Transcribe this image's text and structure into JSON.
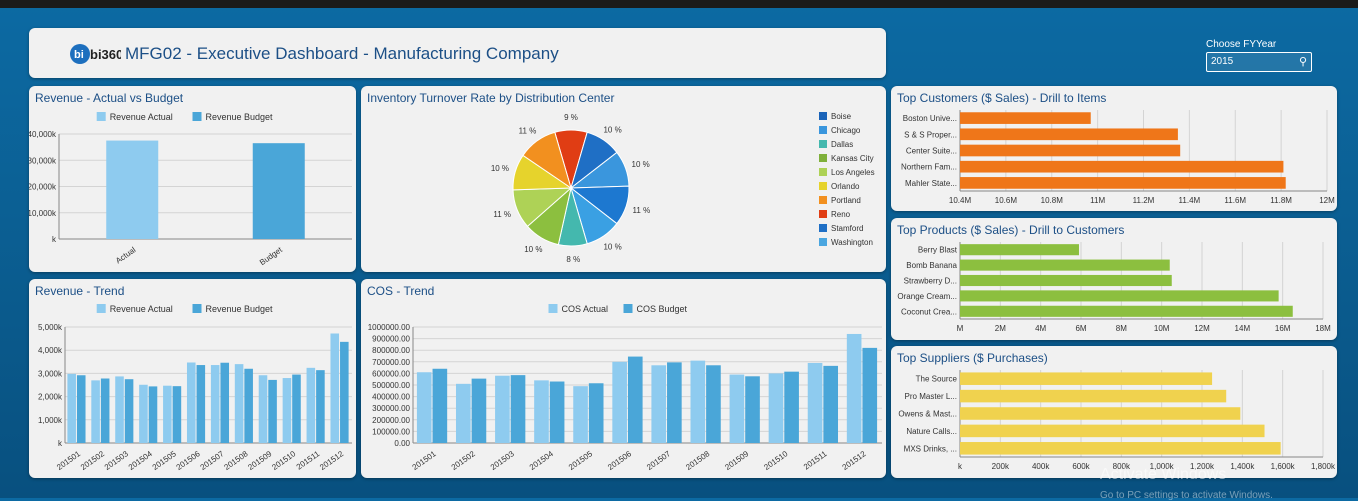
{
  "header": {
    "logo_text": "bi360",
    "title": "MFG02 - Executive Dashboard - Manufacturing Company"
  },
  "filter": {
    "label": "Choose FYYear",
    "value": "2015",
    "icon": "search-icon"
  },
  "watermark": {
    "line1": "Activate Windows",
    "line2": "Go to PC settings to activate Windows."
  },
  "colors": {
    "actual": "#8ecbef",
    "budget": "#4aa6d8",
    "customers": "#ef7619",
    "products": "#8cbf3f",
    "suppliers": "#f0d24e",
    "panel_title": "#1c4f86"
  },
  "panels": {
    "revenue_actual_budget": {
      "title": "Revenue - Actual vs Budget"
    },
    "inventory_turnover": {
      "title": "Inventory Turnover Rate by Distribution Center"
    },
    "revenue_trend": {
      "title": "Revenue - Trend"
    },
    "cos_trend": {
      "title": "COS - Trend"
    },
    "top_customers": {
      "title": "Top Customers ($ Sales) - Drill to Items"
    },
    "top_products": {
      "title": "Top Products ($ Sales) - Drill to Customers"
    },
    "top_suppliers": {
      "title": "Top Suppliers ($ Purchases)"
    }
  },
  "chart_data": [
    {
      "id": "rev_avb",
      "type": "bar",
      "title": "Revenue - Actual vs Budget",
      "categories": [
        "Actual",
        "Budget"
      ],
      "series": [
        {
          "name": "Revenue Actual",
          "values": [
            37500,
            0
          ]
        },
        {
          "name": "Revenue Budget",
          "values": [
            0,
            36500
          ]
        }
      ],
      "yticks": [
        "40,000k",
        "30,000k",
        "20,000k",
        "10,000k",
        "k"
      ],
      "ylim": [
        0,
        40000
      ],
      "legend": "top"
    },
    {
      "id": "inv_pie",
      "type": "pie",
      "title": "Inventory Turnover Rate by Distribution Center",
      "slices": [
        {
          "name": "Boise",
          "value": 10,
          "label": "10 %",
          "color": "#1f6fc5"
        },
        {
          "name": "Chicago",
          "value": 10,
          "label": "10 %",
          "color": "#3a96dd"
        },
        {
          "name": "Dallas",
          "value": 11,
          "label": "11 %",
          "color": "#1d78d0"
        },
        {
          "name": "Kansas City",
          "value": 10,
          "label": "10 %",
          "color": "#3aa0e3"
        },
        {
          "name": "Los Angeles",
          "value": 8,
          "label": "8 %",
          "color": "#44b8ae"
        },
        {
          "name": "Orlando",
          "value": 10,
          "label": "10 %",
          "color": "#8cbf3f"
        },
        {
          "name": "Portland",
          "value": 11,
          "label": "11 %",
          "color": "#aed256"
        },
        {
          "name": "Reno",
          "value": 10,
          "label": "10 %",
          "color": "#e6d32c"
        },
        {
          "name": "Stamford",
          "value": 11,
          "label": "11 %",
          "color": "#f2901f"
        },
        {
          "name": "Washington",
          "value": 9,
          "label": "9 %",
          "color": "#e03d14"
        }
      ],
      "legend": [
        {
          "name": "Boise",
          "color": "#1a63b8"
        },
        {
          "name": "Chicago",
          "color": "#3a96dd"
        },
        {
          "name": "Dallas",
          "color": "#44b8ae"
        },
        {
          "name": "Kansas City",
          "color": "#7fb03b"
        },
        {
          "name": "Los Angeles",
          "color": "#aed256"
        },
        {
          "name": "Orlando",
          "color": "#e6d32c"
        },
        {
          "name": "Portland",
          "color": "#f2901f"
        },
        {
          "name": "Reno",
          "color": "#e03d14"
        },
        {
          "name": "Stamford",
          "color": "#1f6fc5"
        },
        {
          "name": "Washington",
          "color": "#4aa6e0"
        }
      ]
    },
    {
      "id": "rev_trend",
      "type": "bar",
      "title": "Revenue - Trend",
      "categories": [
        "201501",
        "201502",
        "201503",
        "201504",
        "201505",
        "201506",
        "201507",
        "201508",
        "201509",
        "201510",
        "201511",
        "201512"
      ],
      "series": [
        {
          "name": "Revenue Actual",
          "values": [
            2980,
            2700,
            2870,
            2510,
            2470,
            3470,
            3360,
            3400,
            2920,
            2800,
            3240,
            4720
          ]
        },
        {
          "name": "Revenue Budget",
          "values": [
            2920,
            2780,
            2750,
            2440,
            2450,
            3360,
            3460,
            3200,
            2720,
            2950,
            3140,
            4360
          ]
        }
      ],
      "yticks": [
        "5,000k",
        "4,000k",
        "3,000k",
        "2,000k",
        "1,000k",
        "k"
      ],
      "ylim": [
        0,
        5000
      ],
      "legend": "top"
    },
    {
      "id": "cos_trend",
      "type": "bar",
      "title": "COS - Trend",
      "categories": [
        "201501",
        "201502",
        "201503",
        "201504",
        "201505",
        "201506",
        "201507",
        "201508",
        "201509",
        "201510",
        "201511",
        "201512"
      ],
      "series": [
        {
          "name": "COS Actual",
          "values": [
            610000,
            510000,
            580000,
            540000,
            490000,
            700000,
            670000,
            710000,
            590000,
            600000,
            690000,
            940000
          ]
        },
        {
          "name": "COS Budget",
          "values": [
            640000,
            555000,
            585000,
            530000,
            515000,
            745000,
            695000,
            670000,
            575000,
            615000,
            665000,
            820000
          ]
        }
      ],
      "yticks": [
        "1000000.00",
        "900000.00",
        "800000.00",
        "700000.00",
        "600000.00",
        "500000.00",
        "400000.00",
        "300000.00",
        "200000.00",
        "100000.00",
        "0.00"
      ],
      "ylim": [
        0,
        1000000
      ],
      "legend": "top"
    },
    {
      "id": "top_customers",
      "type": "bar",
      "orientation": "horizontal",
      "title": "Top Customers ($ Sales) - Drill to Items",
      "categories": [
        "Boston Unive...",
        "S & S Proper...",
        "Center Suite...",
        "Northern Fam...",
        "Mahler State..."
      ],
      "values": [
        10.97,
        11.35,
        11.36,
        11.81,
        11.82
      ],
      "xticks": [
        "10.4M",
        "10.6M",
        "10.8M",
        "11M",
        "11.2M",
        "11.4M",
        "11.6M",
        "11.8M",
        "12M"
      ],
      "xlim": [
        10.4,
        12.0
      ]
    },
    {
      "id": "top_products",
      "type": "bar",
      "orientation": "horizontal",
      "title": "Top Products ($ Sales) - Drill to Customers",
      "categories": [
        "Berry Blast",
        "Bomb Banana",
        "Strawberry D...",
        "Orange Cream...",
        "Coconut Crea..."
      ],
      "values": [
        5.9,
        10.4,
        10.5,
        15.8,
        16.5
      ],
      "xticks": [
        "M",
        "2M",
        "4M",
        "6M",
        "8M",
        "10M",
        "12M",
        "14M",
        "16M",
        "18M"
      ],
      "xlim": [
        0,
        18
      ]
    },
    {
      "id": "top_suppliers",
      "type": "bar",
      "orientation": "horizontal",
      "title": "Top Suppliers ($ Purchases)",
      "categories": [
        "The Source",
        "Pro Master L...",
        "Owens & Mast...",
        "Nature Calls...",
        "MXS Drinks, ..."
      ],
      "values": [
        1250,
        1320,
        1390,
        1510,
        1590
      ],
      "xticks": [
        "k",
        "200k",
        "400k",
        "600k",
        "800k",
        "1,000k",
        "1,200k",
        "1,400k",
        "1,600k",
        "1,800k"
      ],
      "xlim": [
        0,
        1800
      ]
    }
  ]
}
